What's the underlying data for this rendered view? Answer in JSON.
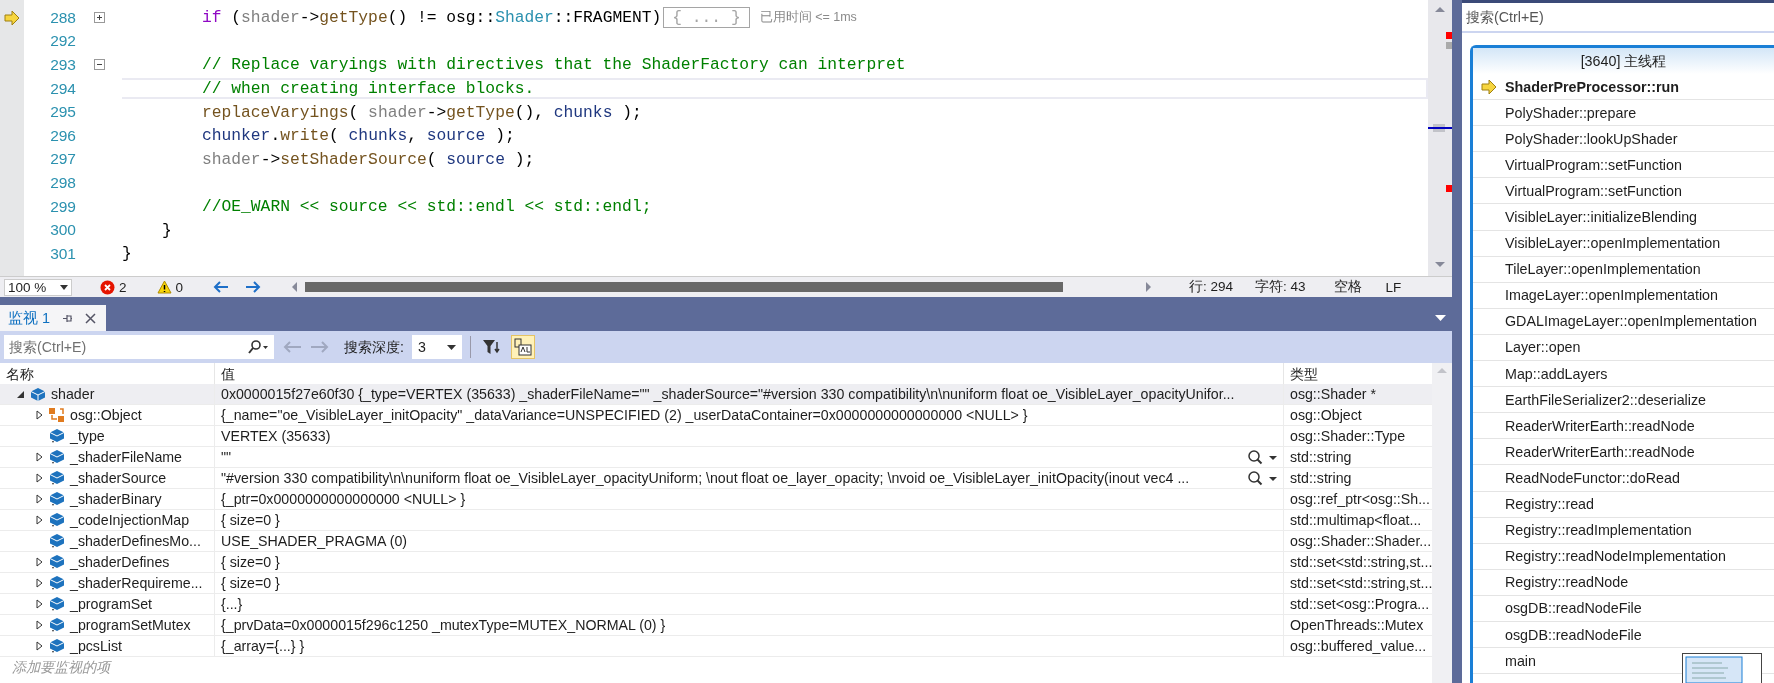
{
  "editor": {
    "lines": [
      {
        "number": "288",
        "kind": "statement",
        "execution_arrow": true,
        "current": false,
        "folded": true,
        "tokens": [
          {
            "kind": "keyword",
            "text": "if"
          },
          {
            "kind": "plain",
            "text": " ("
          },
          {
            "kind": "param",
            "text": "shader"
          },
          {
            "kind": "plain",
            "text": "->"
          },
          {
            "kind": "function",
            "text": "getType"
          },
          {
            "kind": "plain",
            "text": "() != osg::"
          },
          {
            "kind": "type",
            "text": "Shader"
          },
          {
            "kind": "plain",
            "text": "::FRAGMENT)"
          }
        ],
        "collapsed_text": "{ ... }",
        "perf_tip": "已用时间 <= 1ms"
      },
      {
        "number": "292",
        "execution_arrow": false,
        "current": false
      },
      {
        "number": "293",
        "kind": "statement",
        "execution_arrow": false,
        "current": false,
        "folded": false,
        "tokens": [
          {
            "kind": "comment",
            "text": "// Replace varyings with directives that the ShaderFactory can interpret"
          }
        ]
      },
      {
        "number": "294",
        "kind": "statement",
        "execution_arrow": false,
        "current": true,
        "tokens": [
          {
            "kind": "comment",
            "text": "// when creating interface blocks."
          }
        ]
      },
      {
        "number": "295",
        "kind": "statement",
        "execution_arrow": false,
        "current": false,
        "tokens": [
          {
            "kind": "function",
            "text": "replaceVaryings"
          },
          {
            "kind": "plain",
            "text": "( "
          },
          {
            "kind": "param",
            "text": "shader"
          },
          {
            "kind": "plain",
            "text": "->"
          },
          {
            "kind": "function",
            "text": "getType"
          },
          {
            "kind": "plain",
            "text": "(), "
          },
          {
            "kind": "variable",
            "text": "chunks"
          },
          {
            "kind": "plain",
            "text": " );"
          }
        ]
      },
      {
        "number": "296",
        "kind": "statement",
        "execution_arrow": false,
        "current": false,
        "tokens": [
          {
            "kind": "variable",
            "text": "chunker"
          },
          {
            "kind": "plain",
            "text": "."
          },
          {
            "kind": "function",
            "text": "write"
          },
          {
            "kind": "plain",
            "text": "( "
          },
          {
            "kind": "variable",
            "text": "chunks"
          },
          {
            "kind": "plain",
            "text": ", "
          },
          {
            "kind": "variable",
            "text": "source"
          },
          {
            "kind": "plain",
            "text": " );"
          }
        ]
      },
      {
        "number": "297",
        "kind": "statement",
        "execution_arrow": false,
        "current": false,
        "tokens": [
          {
            "kind": "param",
            "text": "shader"
          },
          {
            "kind": "plain",
            "text": "->"
          },
          {
            "kind": "function",
            "text": "setShaderSource"
          },
          {
            "kind": "plain",
            "text": "( "
          },
          {
            "kind": "variable",
            "text": "source"
          },
          {
            "kind": "plain",
            "text": " );"
          }
        ]
      },
      {
        "number": "298",
        "execution_arrow": false,
        "current": false
      },
      {
        "number": "299",
        "kind": "statement",
        "execution_arrow": false,
        "current": false,
        "tokens": [
          {
            "kind": "comment",
            "text": "//OE_WARN << source << std::endl << std::endl;"
          }
        ]
      },
      {
        "number": "300",
        "kind": "inner_brace",
        "execution_arrow": false,
        "current": false,
        "tokens": [
          {
            "kind": "plain",
            "text": "}"
          }
        ]
      },
      {
        "number": "301",
        "kind": "outer_brace",
        "execution_arrow": false,
        "current": false,
        "tokens": [
          {
            "kind": "plain",
            "text": "}"
          }
        ]
      }
    ],
    "status": {
      "zoom": "100 %",
      "errors": "2",
      "warnings": "0",
      "line": "行: 294",
      "column": "字符: 43",
      "indent_mode": "空格",
      "line_ending": "LF"
    }
  },
  "watch": {
    "tab": {
      "label": "监视 1",
      "selected": true
    },
    "search": {
      "placeholder": "搜索(Ctrl+E)"
    },
    "depth_label": "搜索深度:",
    "depth_value": "3",
    "toggles": [
      {
        "kind": "filter",
        "selected": false
      },
      {
        "kind": "hex",
        "selected": true
      }
    ],
    "columns": [
      "名称",
      "值",
      "类型"
    ],
    "rows": [
      {
        "kind": "object",
        "name": "shader",
        "value": "0x0000015f27e60f30 {_type=VERTEX (35633) _shaderFileName=\"\" _shaderSource=\"#version 330 compatibility\\n\\nuniform float oe_VisibleLayer_opacityUnifor...",
        "type": "osg::Shader *",
        "expandable": true,
        "expanded": true,
        "selected": true,
        "visualizer": false,
        "children": [
          {
            "kind": "base",
            "name": "osg::Object",
            "value": "{_name=\"oe_VisibleLayer_initOpacity\" _dataVariance=UNSPECIFIED (2) _userDataContainer=0x0000000000000000 <NULL> }",
            "type": "osg::Object",
            "expandable": true,
            "expanded": false,
            "selected": false,
            "visualizer": false
          },
          {
            "kind": "field",
            "name": "_type",
            "value": "VERTEX (35633)",
            "type": "osg::Shader::Type",
            "expandable": false,
            "selected": false,
            "visualizer": false
          },
          {
            "kind": "field",
            "name": "_shaderFileName",
            "value": "\"\"",
            "type": "std::string",
            "expandable": true,
            "expanded": false,
            "selected": false,
            "visualizer": true
          },
          {
            "kind": "field",
            "name": "_shaderSource",
            "value": "\"#version 330 compatibility\\n\\nuniform float oe_VisibleLayer_opacityUniform; \\nout float oe_layer_opacity; \\nvoid oe_VisibleLayer_initOpacity(inout vec4 ...",
            "type": "std::string",
            "expandable": true,
            "expanded": false,
            "selected": false,
            "visualizer": true
          },
          {
            "kind": "field",
            "name": "_shaderBinary",
            "value": "{_ptr=0x0000000000000000 <NULL> }",
            "type": "osg::ref_ptr<osg::Sh...",
            "expandable": true,
            "expanded": false,
            "selected": false,
            "visualizer": false
          },
          {
            "kind": "field",
            "name": "_codeInjectionMap",
            "value": "{ size=0 }",
            "type": "std::multimap<float...",
            "expandable": true,
            "expanded": false,
            "selected": false,
            "visualizer": false
          },
          {
            "kind": "field",
            "name": "_shaderDefinesMo...",
            "value": "USE_SHADER_PRAGMA (0)",
            "type": "osg::Shader::Shader...",
            "expandable": false,
            "selected": false,
            "visualizer": false
          },
          {
            "kind": "field",
            "name": "_shaderDefines",
            "value": "{ size=0 }",
            "type": "std::set<std::string,st...",
            "expandable": true,
            "expanded": false,
            "selected": false,
            "visualizer": false
          },
          {
            "kind": "field",
            "name": "_shaderRequireme...",
            "value": "{ size=0 }",
            "type": "std::set<std::string,st...",
            "expandable": true,
            "expanded": false,
            "selected": false,
            "visualizer": false
          },
          {
            "kind": "field",
            "name": "_programSet",
            "value": "{...}",
            "type": "std::set<osg::Progra...",
            "expandable": true,
            "expanded": false,
            "selected": false,
            "visualizer": false
          },
          {
            "kind": "field",
            "name": "_programSetMutex",
            "value": "{_prvData=0x0000015f296c1250 _mutexType=MUTEX_NORMAL (0) }",
            "type": "OpenThreads::Mutex",
            "expandable": true,
            "expanded": false,
            "selected": false,
            "visualizer": false
          },
          {
            "kind": "field",
            "name": "_pcsList",
            "value": "{_array={...} }",
            "type": "osg::buffered_value...",
            "expandable": true,
            "expanded": false,
            "selected": false,
            "visualizer": false
          }
        ]
      }
    ],
    "add_placeholder": "添加要监视的项"
  },
  "stacks": {
    "search": {
      "placeholder": "搜索(Ctrl+E)"
    },
    "thread_title": "[3640] 主线程",
    "frames": [
      {
        "label": "ShaderPreProcessor::run",
        "current": true
      },
      {
        "label": "PolyShader::prepare",
        "current": false
      },
      {
        "label": "PolyShader::lookUpShader",
        "current": false
      },
      {
        "label": "VirtualProgram::setFunction",
        "current": false
      },
      {
        "label": "VirtualProgram::setFunction",
        "current": false
      },
      {
        "label": "VisibleLayer::initializeBlending",
        "current": false
      },
      {
        "label": "VisibleLayer::openImplementation",
        "current": false
      },
      {
        "label": "TileLayer::openImplementation",
        "current": false
      },
      {
        "label": "ImageLayer::openImplementation",
        "current": false
      },
      {
        "label": "GDALImageLayer::openImplementation",
        "current": false
      },
      {
        "label": "Layer::open",
        "current": false
      },
      {
        "label": "Map::addLayers",
        "current": false
      },
      {
        "label": "EarthFileSerializer2::deserialize",
        "current": false
      },
      {
        "label": "ReaderWriterEarth::readNode",
        "current": false
      },
      {
        "label": "ReaderWriterEarth::readNode",
        "current": false
      },
      {
        "label": "ReadNodeFunctor::doRead",
        "current": false
      },
      {
        "label": "Registry::read",
        "current": false
      },
      {
        "label": "Registry::readImplementation",
        "current": false
      },
      {
        "label": "Registry::readNodeImplementation",
        "current": false
      },
      {
        "label": "Registry::readNode",
        "current": false
      },
      {
        "label": "osgDB::readNodeFile",
        "current": false
      },
      {
        "label": "osgDB::readNodeFile",
        "current": false
      },
      {
        "label": "main",
        "current": false
      }
    ]
  }
}
